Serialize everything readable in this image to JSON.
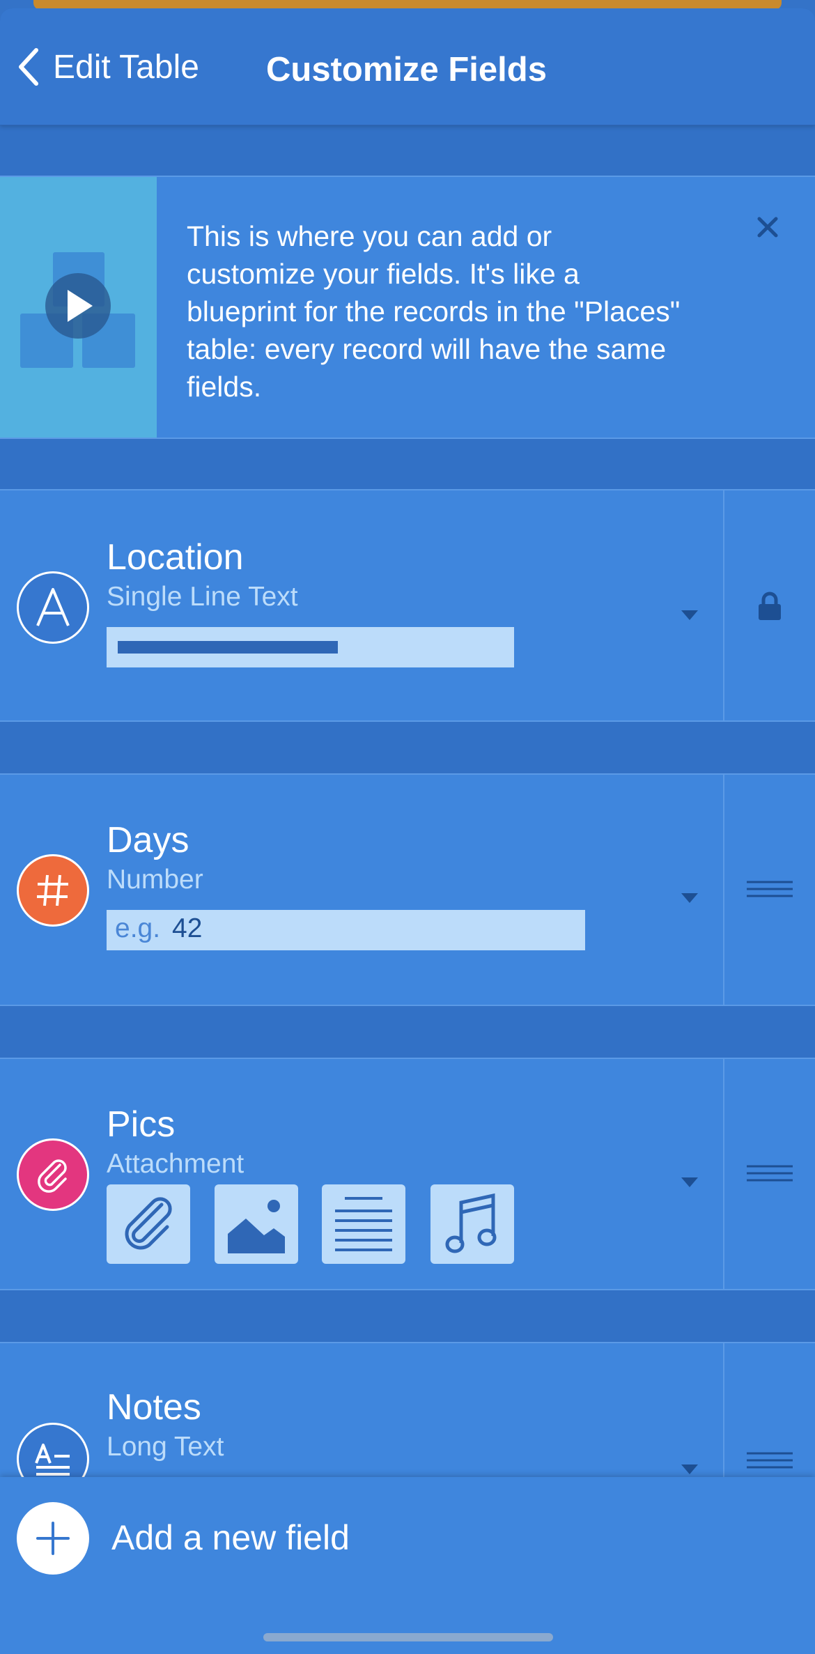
{
  "nav": {
    "back_label": "Edit Table",
    "title": "Customize Fields"
  },
  "info": {
    "text": "This is where you can add or customize your fields. It's like a blueprint for the records in the \"Places\" table: every record will have the same fields."
  },
  "fields": [
    {
      "name": "Location",
      "type": "Single Line Text",
      "icon": "text-a-icon",
      "icon_color": "#3677cf",
      "side": "lock-icon"
    },
    {
      "name": "Days",
      "type": "Number",
      "icon": "hash-icon",
      "icon_color": "#ee6a3c",
      "side": "drag-handle-icon",
      "placeholder_prefix": "e.g.",
      "placeholder_value": "42"
    },
    {
      "name": "Pics",
      "type": "Attachment",
      "icon": "paperclip-icon",
      "icon_color": "#e3367f",
      "side": "drag-handle-icon"
    },
    {
      "name": "Notes",
      "type": "Long Text",
      "icon": "long-text-icon",
      "icon_color": "#3677cf",
      "side": "drag-handle-icon"
    }
  ],
  "add_field": {
    "label": "Add a new field"
  },
  "colors": {
    "background": "#3271c6",
    "row": "#3f86dd",
    "preview": "#bcdcfa",
    "accent_orange": "#ee6a3c",
    "accent_pink": "#e3367f"
  }
}
